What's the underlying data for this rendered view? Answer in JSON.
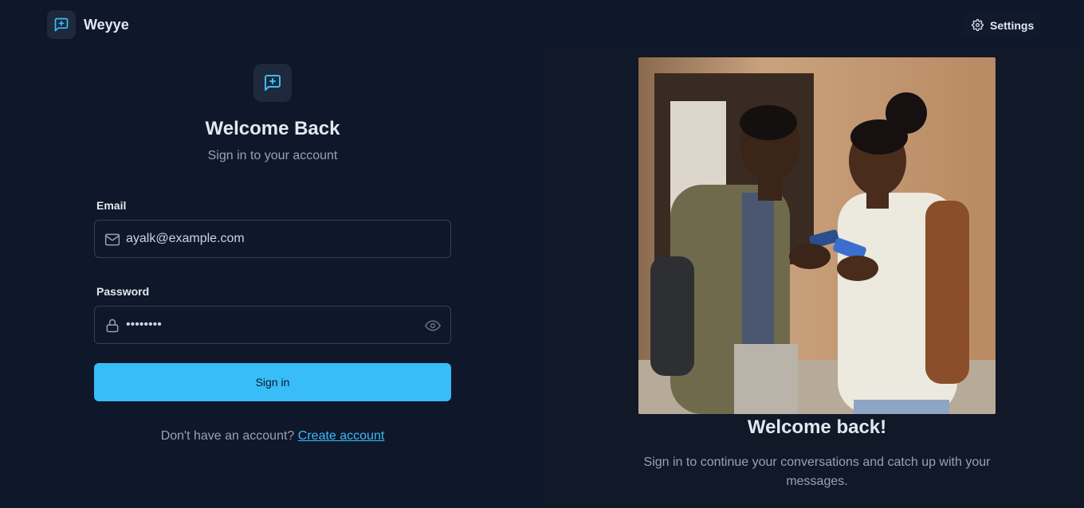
{
  "app": {
    "brand": "Weyye",
    "settings_label": "Settings"
  },
  "form": {
    "title": "Welcome Back",
    "subtitle": "Sign in to your account",
    "email_label": "Email",
    "email_value": "ayalk@example.com",
    "password_label": "Password",
    "password_value": "••••••••",
    "submit_label": "Sign in",
    "no_account_text": "Don't have an account?",
    "create_account_link": "Create account"
  },
  "hero": {
    "title": "Welcome back!",
    "text": "Sign in to continue your conversations and catch up with your messages."
  },
  "icons": {
    "logo": "message-plus-icon",
    "settings": "gear-icon",
    "email": "mail-icon",
    "password": "lock-icon",
    "reveal": "eye-icon"
  },
  "colors": {
    "background": "#0f172a",
    "accent": "#38bdf8"
  }
}
